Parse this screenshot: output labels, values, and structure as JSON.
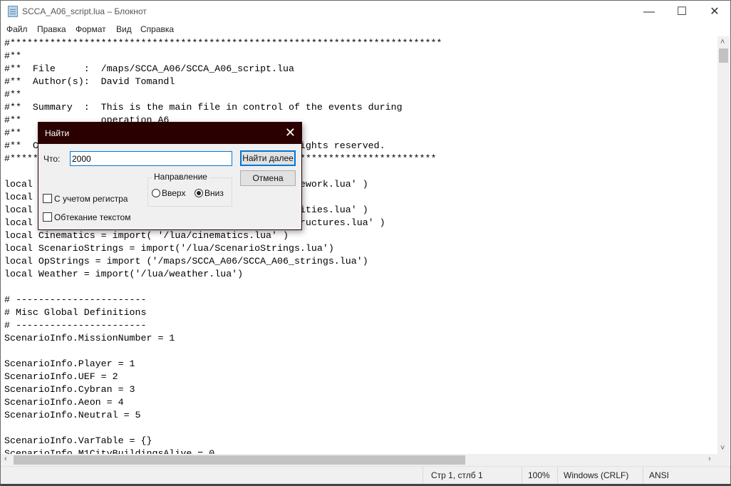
{
  "window": {
    "title": "SCCA_A06_script.lua – Блокнот",
    "icon": "notepad-icon",
    "minimize": "—",
    "maximize": "☐",
    "close": "✕"
  },
  "menu": [
    "Файл",
    "Правка",
    "Формат",
    "Вид",
    "Справка"
  ],
  "editor": {
    "lines": [
      "#****************************************************************************",
      "#**",
      "#**  File     :  /maps/SCCA_A06/SCCA_A06_script.lua",
      "#**  Author(s):  David Tomandl",
      "#**",
      "#**  Summary  :  This is the main file in control of the events during",
      "#**              operation A6",
      "#**",
      "#**  C                                              ights reserved.",
      "#*****                                              ************************",
      "",
      "local                                               ework.lua' )",
      "local",
      "local                                               ities.lua' )",
      "local                                               ructures.lua' )",
      "local Cinematics = import( '/lua/cinematics.lua' )",
      "local ScenarioStrings = import('/lua/ScenarioStrings.lua')",
      "local OpStrings = import ('/maps/SCCA_A06/SCCA_A06_strings.lua')",
      "local Weather = import('/lua/weather.lua')",
      "",
      "# -----------------------",
      "# Misc Global Definitions",
      "# -----------------------",
      "ScenarioInfo.MissionNumber = 1",
      "",
      "ScenarioInfo.Player = 1",
      "ScenarioInfo.UEF = 2",
      "ScenarioInfo.Cybran = 3",
      "ScenarioInfo.Aeon = 4",
      "ScenarioInfo.Neutral = 5",
      "",
      "ScenarioInfo.VarTable = {}",
      "ScenarioInfo.M1CityBuildingsAlive = 0"
    ]
  },
  "status": {
    "position": "Стр 1, стлб 1",
    "zoom": "100%",
    "line_ending": "Windows (CRLF)",
    "encoding": "ANSI"
  },
  "find_dialog": {
    "title": "Найти",
    "what_label": "Что:",
    "what_value": "2000",
    "find_next": "Найти далее",
    "cancel": "Отмена",
    "direction_label": "Направление",
    "up": "Вверх",
    "down": "Вниз",
    "direction_selected": "down",
    "match_case": "С учетом регистра",
    "match_case_checked": false,
    "wrap": "Обтекание текстом",
    "wrap_checked": false,
    "title_color": "#2b0000"
  }
}
